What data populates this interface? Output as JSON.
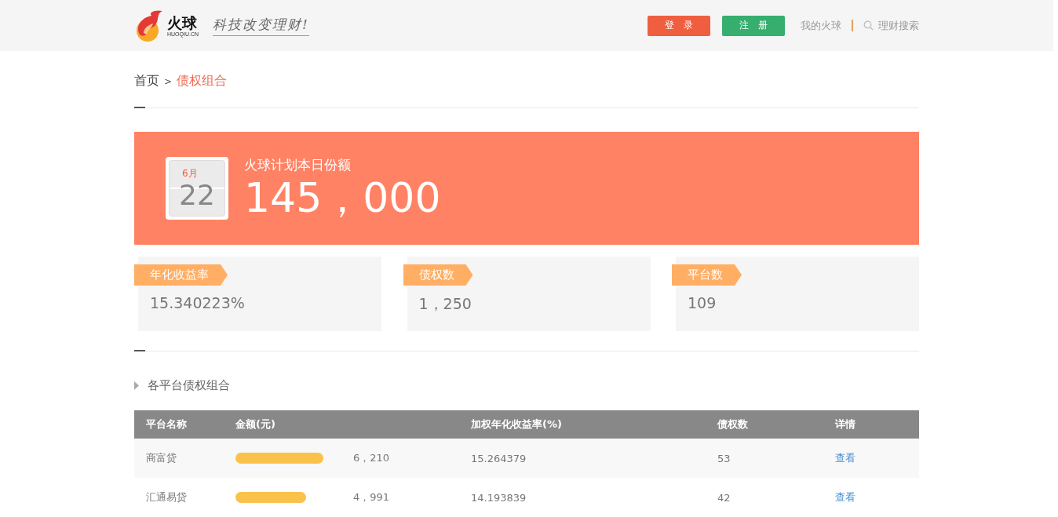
{
  "header": {
    "logo_text": "火球",
    "logo_domain": "HUOQIU.CN",
    "slogan": "科技改变理财!",
    "login_button": "登　录",
    "register_button": "注　册",
    "my_link": "我的火球",
    "search_link": "理财搜索"
  },
  "breadcrumb": {
    "home": "首页",
    "separator": ">",
    "current": "债权组合"
  },
  "banner": {
    "month": "6月",
    "day": "22",
    "title": "火球计划本日份额",
    "amount": "145，000"
  },
  "stats": [
    {
      "label": "年化收益率",
      "value": "15.340223%"
    },
    {
      "label": "债权数",
      "value": "1，250"
    },
    {
      "label": "平台数",
      "value": "109"
    }
  ],
  "section_title": "各平台债权组合",
  "table": {
    "columns": [
      "平台名称",
      "金额(元)",
      "加权年化收益率(%)",
      "债权数",
      "详情"
    ],
    "rows": [
      {
        "platform": "商富贷",
        "level": 0.8,
        "amount": "6，210",
        "rate": "15.264379",
        "count": "53",
        "link": "查看"
      },
      {
        "platform": "汇通易贷",
        "level": 0.643,
        "amount": "4，991",
        "rate": "14.193839",
        "count": "42",
        "link": "查看"
      }
    ]
  }
}
